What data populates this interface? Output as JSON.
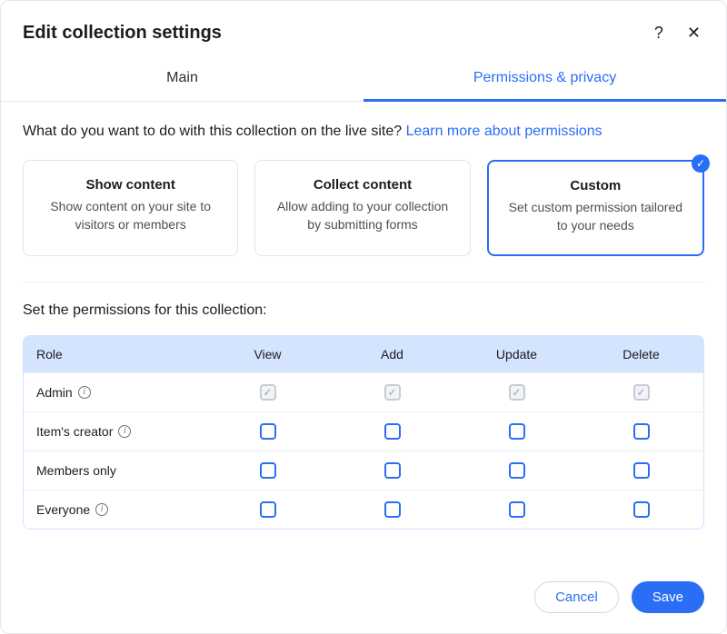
{
  "dialog": {
    "title": "Edit collection settings",
    "help_label": "?",
    "close_label": "✕"
  },
  "tabs": {
    "main": "Main",
    "permissions": "Permissions & privacy",
    "active": "permissions"
  },
  "permissions": {
    "prompt_text": "What do you want to do with this collection on the live site? ",
    "learn_more": "Learn more about permissions",
    "options": [
      {
        "key": "show",
        "title": "Show content",
        "desc": "Show content on your site to visitors or members",
        "selected": false
      },
      {
        "key": "collect",
        "title": "Collect content",
        "desc": "Allow adding to your collection by submitting forms",
        "selected": false
      },
      {
        "key": "custom",
        "title": "Custom",
        "desc": "Set custom permission tailored to your needs",
        "selected": true
      }
    ],
    "table_heading": "Set the permissions for this collection:",
    "columns": {
      "role": "Role",
      "view": "View",
      "add": "Add",
      "update": "Update",
      "delete": "Delete"
    },
    "roles": [
      {
        "name": "Admin",
        "info": true,
        "locked": true,
        "view": true,
        "add": true,
        "update": true,
        "delete": true
      },
      {
        "name": "Item's creator",
        "info": true,
        "locked": false,
        "view": false,
        "add": false,
        "update": false,
        "delete": false
      },
      {
        "name": "Members only",
        "info": false,
        "locked": false,
        "view": false,
        "add": false,
        "update": false,
        "delete": false
      },
      {
        "name": "Everyone",
        "info": true,
        "locked": false,
        "view": false,
        "add": false,
        "update": false,
        "delete": false
      }
    ]
  },
  "footer": {
    "cancel": "Cancel",
    "save": "Save"
  }
}
